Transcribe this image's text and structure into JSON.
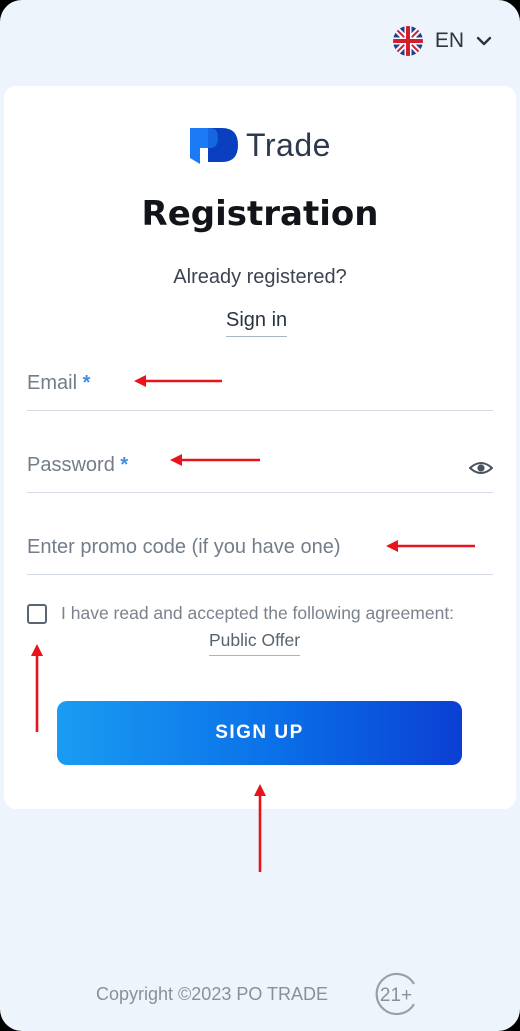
{
  "header": {
    "language": "EN",
    "flag_icon": "uk-flag-icon",
    "dropdown_icon": "chevron-down-icon"
  },
  "brand": {
    "logo_text": "Trade",
    "logo_colors": [
      "#1b6ef5",
      "#0a3fbf"
    ]
  },
  "form": {
    "title": "Registration",
    "already_registered": "Already registered?",
    "sign_in_link": "Sign in",
    "email": {
      "placeholder": "Email",
      "required_mark": "*",
      "value": ""
    },
    "password": {
      "placeholder": "Password",
      "required_mark": "*",
      "value": "",
      "toggle_icon": "eye-icon"
    },
    "promo": {
      "placeholder": "Enter promo code (if you have one)",
      "value": ""
    },
    "agreement_text": "I have read and accepted the following agreement:",
    "agreement_link": "Public Offer",
    "agreement_checked": false,
    "submit_label": "SIGN UP"
  },
  "footer": {
    "copyright": "Copyright ©2023 PO TRADE",
    "age_badge": "21+"
  },
  "annotations": {
    "arrow_color": "#e8141b",
    "arrow_count": 5
  }
}
